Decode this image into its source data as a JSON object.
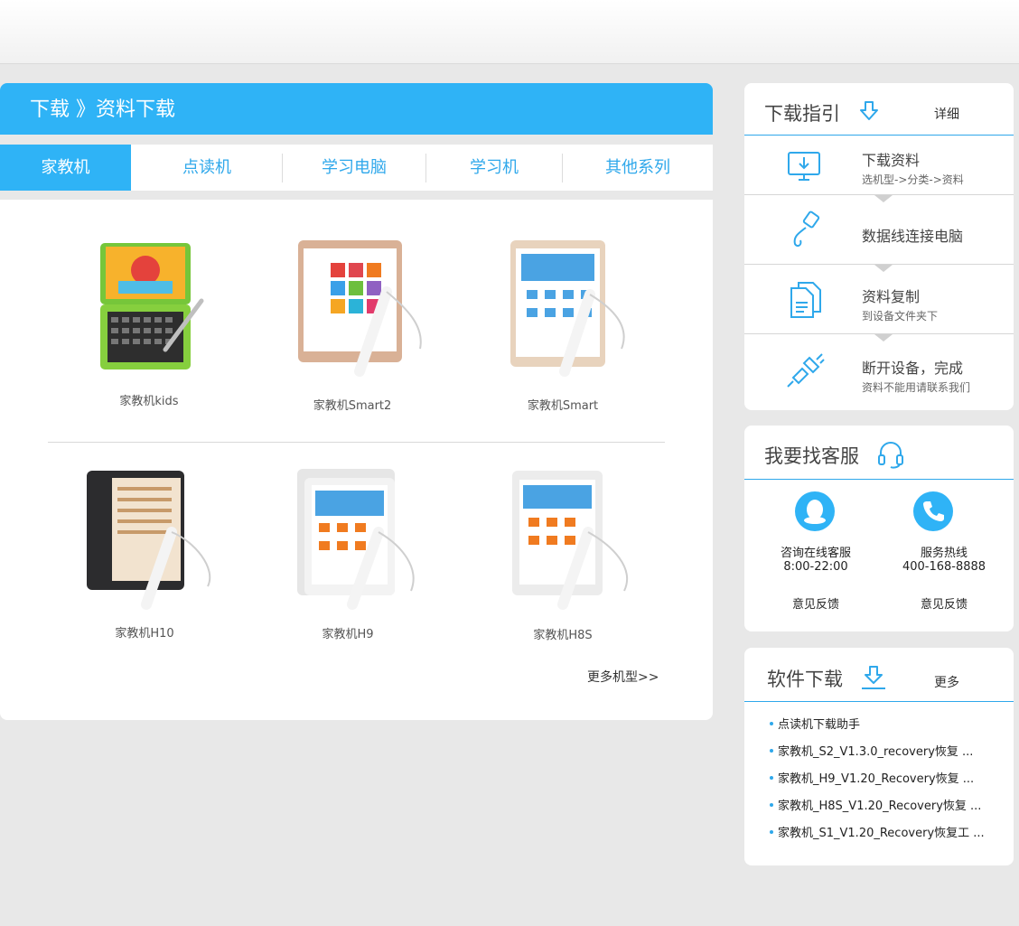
{
  "breadcrumb": "下载 》资料下载",
  "tabs": [
    {
      "label": "家教机",
      "active": true
    },
    {
      "label": "点读机",
      "active": false
    },
    {
      "label": "学习电脑",
      "active": false
    },
    {
      "label": "学习机",
      "active": false
    },
    {
      "label": "其他系列",
      "active": false
    }
  ],
  "products": [
    {
      "name": "家教机kids"
    },
    {
      "name": "家教机Smart2"
    },
    {
      "name": "家教机Smart"
    },
    {
      "name": "家教机H10"
    },
    {
      "name": "家教机H9"
    },
    {
      "name": "家教机H8S"
    }
  ],
  "more_models": "更多机型>>",
  "guide": {
    "title": "下载指引",
    "link": "详细",
    "steps": [
      {
        "title": "下载资料",
        "sub": "选机型->分类->资料",
        "icon": "monitor-download-icon"
      },
      {
        "title": "数据线连接电脑",
        "sub": "",
        "icon": "usb-cable-icon"
      },
      {
        "title": "资料复制",
        "sub": "到设备文件夹下",
        "icon": "copy-files-icon"
      },
      {
        "title": "断开设备，完成",
        "sub": "资料不能用请联系我们",
        "icon": "unplug-icon"
      }
    ]
  },
  "service": {
    "title": "我要找客服",
    "online_label": "咨询在线客服",
    "online_hours": "8:00-22:00",
    "hotline_label": "服务热线",
    "hotline_number": "400-168-8888",
    "feedback_left": "意见反馈",
    "feedback_right": "意见反馈"
  },
  "software": {
    "title": "软件下载",
    "link": "更多",
    "items": [
      "点读机下载助手",
      "家教机_S2_V1.3.0_recovery恢复 ...",
      "家教机_H9_V1.20_Recovery恢复 ...",
      "家教机_H8S_V1.20_Recovery恢复 ...",
      "家教机_S1_V1.20_Recovery恢复工 ..."
    ]
  },
  "colors": {
    "accent": "#2fb3f6",
    "link": "#2fa8eb",
    "background": "#e8e8e8"
  }
}
